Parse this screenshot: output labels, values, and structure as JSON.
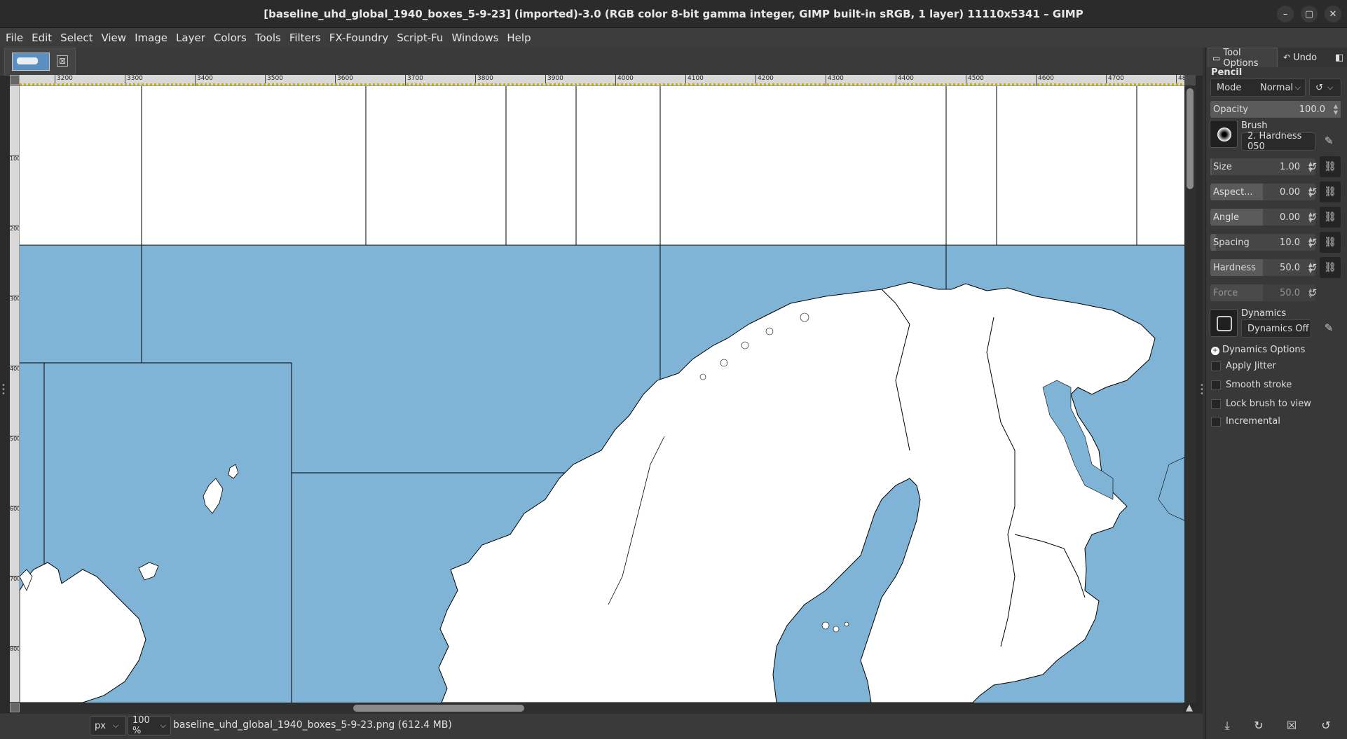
{
  "window": {
    "title": "[baseline_uhd_global_1940_boxes_5-9-23] (imported)-3.0 (RGB color 8-bit gamma integer, GIMP built-in sRGB, 1 layer) 11110x5341 – GIMP",
    "minimize": "–",
    "maximize": "▢",
    "close": "✕"
  },
  "menu": [
    "File",
    "Edit",
    "Select",
    "View",
    "Image",
    "Layer",
    "Colors",
    "Tools",
    "Filters",
    "FX-Foundry",
    "Script-Fu",
    "Windows",
    "Help"
  ],
  "image_tab": {
    "close": "⊠"
  },
  "ruler": {
    "h_ticks": [
      "3200",
      "3300",
      "3400",
      "3500",
      "3600",
      "3700",
      "3800",
      "3900",
      "4000",
      "4100",
      "4200",
      "4300",
      "4400",
      "4500",
      "4600",
      "4700",
      "48"
    ],
    "v_ticks": [
      "100",
      "200",
      "300",
      "400",
      "500",
      "600",
      "700",
      "800"
    ]
  },
  "status": {
    "unit": "px",
    "zoom": "100 %",
    "file": "baseline_uhd_global_1940_boxes_5-9-23.png (612.4 MB)"
  },
  "dock": {
    "tabs": [
      "Tool Options",
      "Undo"
    ],
    "tool_name": "Pencil",
    "mode_label": "Mode",
    "mode_value": "Normal",
    "opacity_label": "Opacity",
    "opacity_value": "100.0",
    "opacity_fill": 1.0,
    "brush_label": "Brush",
    "brush_name": "2. Hardness 050",
    "params": [
      {
        "label": "Size",
        "value": "1.00",
        "fill": 0.01
      },
      {
        "label": "Aspect...",
        "value": "0.00",
        "fill": 0.5
      },
      {
        "label": "Angle",
        "value": "0.00",
        "fill": 0.5
      },
      {
        "label": "Spacing",
        "value": "10.0",
        "fill": 0.05
      },
      {
        "label": "Hardness",
        "value": "50.0",
        "fill": 0.5
      },
      {
        "label": "Force",
        "value": "50.0",
        "fill": 0.5
      }
    ],
    "dynamics_label": "Dynamics",
    "dynamics_value": "Dynamics Off",
    "dynamics_options": "Dynamics Options",
    "checkboxes": [
      "Apply Jitter",
      "Smooth stroke",
      "Lock brush to view",
      "Incremental"
    ]
  },
  "colors": {
    "sea": "#7fb4d6",
    "land": "#ffffff",
    "border": "#000000"
  }
}
